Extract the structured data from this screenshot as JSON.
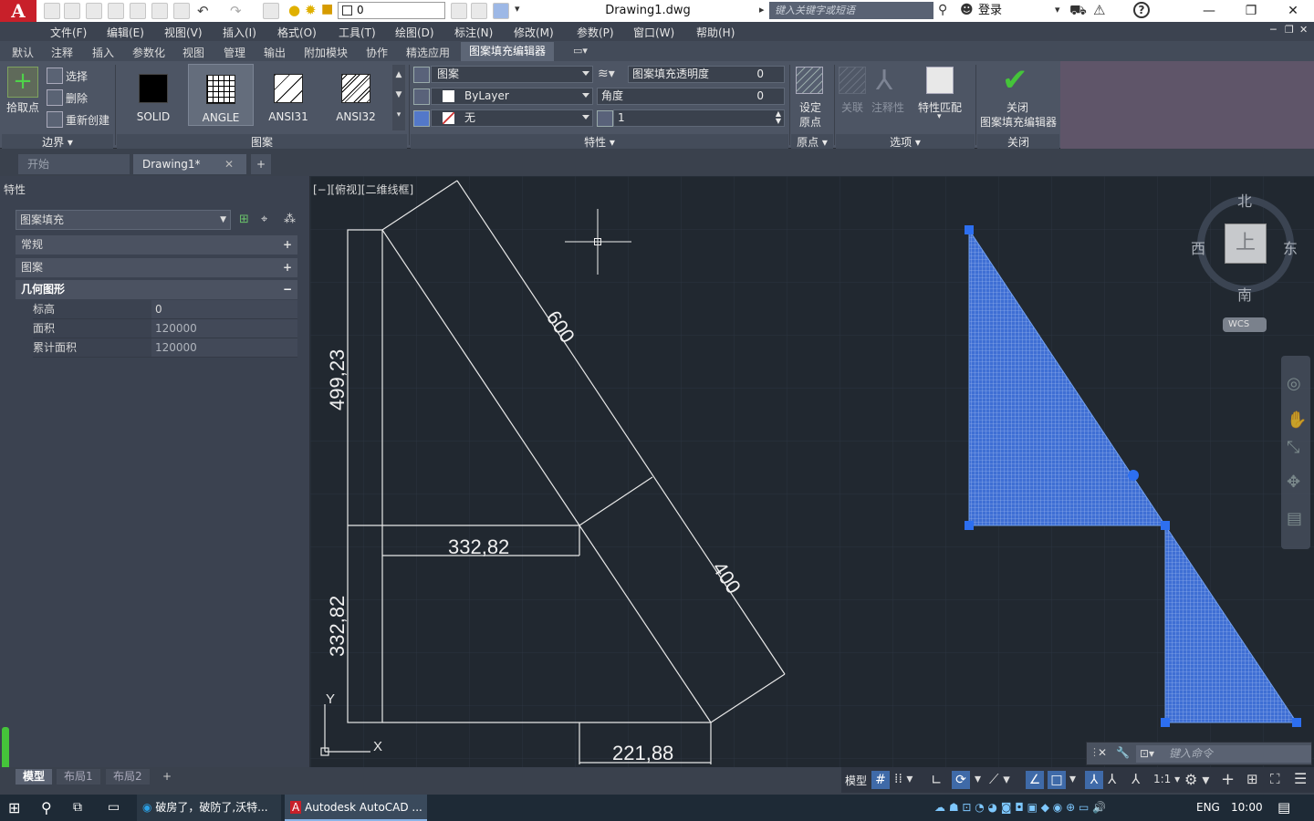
{
  "app": {
    "logo": "A",
    "document_title": "Drawing1.dwg"
  },
  "quick_access": {
    "layer_value": "0"
  },
  "search": {
    "placeholder": "键入关键字或短语"
  },
  "user": {
    "login_label": "登录"
  },
  "window_controls": {
    "minimize": "—",
    "restore": "❐",
    "close": "✕"
  },
  "menu": [
    "文件(F)",
    "编辑(E)",
    "视图(V)",
    "插入(I)",
    "格式(O)",
    "工具(T)",
    "绘图(D)",
    "标注(N)",
    "修改(M)",
    "参数(P)",
    "窗口(W)",
    "帮助(H)"
  ],
  "ribbon_tabs": [
    "默认",
    "注释",
    "插入",
    "参数化",
    "视图",
    "管理",
    "输出",
    "附加模块",
    "协作",
    "精选应用"
  ],
  "ribbon_active_tab": "图案填充编辑器",
  "ribbon": {
    "boundary": {
      "pick_point": "拾取点",
      "select": "选择",
      "remove": "删除",
      "recreate": "重新创建",
      "group_label": "边界"
    },
    "pattern": {
      "group_label": "图案",
      "items": [
        {
          "name": "SOLID",
          "type": "solid"
        },
        {
          "name": "ANGLE",
          "type": "grid"
        },
        {
          "name": "ANSI31",
          "type": "hatch"
        },
        {
          "name": "ANSI32",
          "type": "hatch"
        }
      ]
    },
    "properties": {
      "group_label": "特性",
      "pattern_type": "图案",
      "color": "ByLayer",
      "background": "无",
      "transparency_label": "图案填充透明度",
      "transparency_value": "0",
      "angle_label": "角度",
      "angle_value": "0",
      "scale_value": "1"
    },
    "origin": {
      "set_origin_l1": "设定",
      "set_origin_l2": "原点",
      "group_label": "原点"
    },
    "options": {
      "associative": "关联",
      "annotative": "注释性",
      "match_props": "特性匹配",
      "group_label": "选项"
    },
    "close": {
      "label_l1": "关闭",
      "label_l2": "图案填充编辑器",
      "group_label": "关闭"
    }
  },
  "doc_tabs": {
    "start": "开始",
    "drawing": "Drawing1*",
    "add": "+"
  },
  "properties_panel": {
    "title": "特性",
    "selection": "图案填充",
    "sections": [
      {
        "label": "常规",
        "toggle": "+"
      },
      {
        "label": "图案",
        "toggle": "+"
      },
      {
        "label": "几何图形",
        "toggle": "−"
      }
    ],
    "geometry": [
      {
        "label": "标高",
        "value": "0"
      },
      {
        "label": "面积",
        "value": "120000"
      },
      {
        "label": "累计面积",
        "value": "120000"
      }
    ]
  },
  "viewport": {
    "label": "[−][俯视][二维线框]"
  },
  "viewcube": {
    "north": "北",
    "south": "南",
    "east": "东",
    "west": "西",
    "top": "上",
    "wcs": "WCS"
  },
  "dimensions": {
    "d1": "600",
    "d2": "400",
    "d3": "499,23",
    "d4": "332,82",
    "d5": "332,82",
    "d6": "221,88"
  },
  "ucs": {
    "x": "X",
    "y": "Y"
  },
  "command": {
    "placeholder": "键入命令"
  },
  "layout_tabs": [
    "模型",
    "布局1",
    "布局2"
  ],
  "status": {
    "model": "模型",
    "scale": "1:1"
  },
  "taskbar": {
    "browser_title": "破房了，破防了,沃特...",
    "app_title": "Autodesk AutoCAD ...",
    "lang": "ENG",
    "time": "10:00"
  },
  "colors": {
    "hatch_blue": "#3f6fd4",
    "accent_green": "#45c43a",
    "cad_red": "#c8202a"
  }
}
